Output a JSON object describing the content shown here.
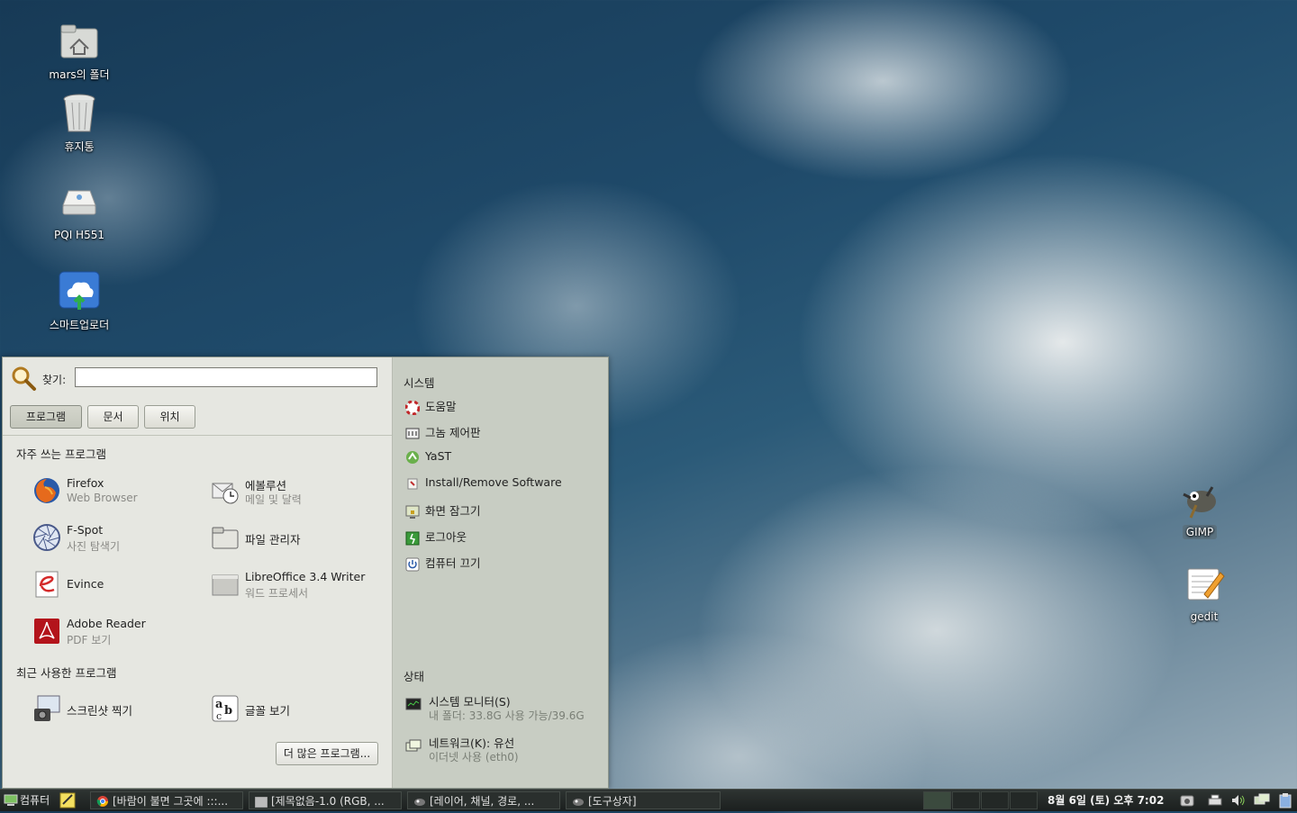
{
  "desktop": {
    "icons": [
      {
        "label": "mars의 폴더"
      },
      {
        "label": "휴지통"
      },
      {
        "label": "PQI H551"
      },
      {
        "label": "스마트업로더"
      },
      {
        "label": "GIMP"
      },
      {
        "label": "gedit"
      }
    ]
  },
  "menu": {
    "search_label": "찾기:",
    "search_value": "",
    "tabs": [
      {
        "label": "프로그램"
      },
      {
        "label": "문서"
      },
      {
        "label": "위치"
      }
    ],
    "favorites_title": "자주 쓰는 프로그램",
    "favorites": [
      {
        "name": "Firefox",
        "sub": "Web Browser"
      },
      {
        "name": "에볼루션",
        "sub": "메일 및 달력"
      },
      {
        "name": "F-Spot",
        "sub": "사진 탐색기"
      },
      {
        "name": "파일 관리자",
        "sub": ""
      },
      {
        "name": "Evince",
        "sub": ""
      },
      {
        "name": "LibreOffice 3.4 Writer",
        "sub": "워드 프로세서"
      },
      {
        "name": "Adobe Reader",
        "sub": "PDF 보기"
      }
    ],
    "recent_title": "최근 사용한 프로그램",
    "recent": [
      {
        "name": "스크린샷 찍기"
      },
      {
        "name": "글꼴 보기"
      }
    ],
    "more_button": "더 많은 프로그램...",
    "system_title": "시스템",
    "system_items": [
      {
        "label": "도움말"
      },
      {
        "label": "그놈 제어판"
      },
      {
        "label": "YaST"
      },
      {
        "label": "Install/Remove Software"
      },
      {
        "label": "화면 잠그기"
      },
      {
        "label": "로그아웃"
      },
      {
        "label": "컴퓨터 끄기"
      }
    ],
    "status_title": "상태",
    "status_items": [
      {
        "name": "시스템 모니터(S)",
        "detail": "내 폴더: 33.8G 사용 가능/39.6G"
      },
      {
        "name": "네트워크(K): 유선",
        "detail": "이더넷 사용 (eth0)"
      }
    ]
  },
  "taskbar": {
    "start_label": "컴퓨터",
    "tasks": [
      {
        "label": "[바람이 불면 그곳에 :::..."
      },
      {
        "label": "[제목없음-1.0 (RGB, ..."
      },
      {
        "label": "[레이어, 채널, 경로, ..."
      },
      {
        "label": "[도구상자]"
      }
    ],
    "clock": "8월  6일 (토) 오후  7:02"
  },
  "colors": {
    "menu_left_bg": "#e6e7e1",
    "menu_right_bg": "#c8cdc3",
    "taskbar_bg": "#1b1f1e"
  }
}
